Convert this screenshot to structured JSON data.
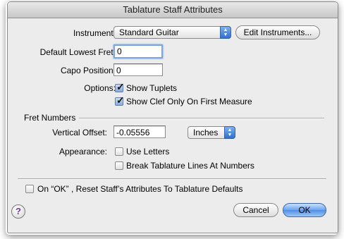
{
  "window": {
    "title": "Tablature Staff Attributes"
  },
  "instrument": {
    "label": "Instrument:",
    "value": "Standard Guitar",
    "edit_button": "Edit Instruments..."
  },
  "lowest_fret": {
    "label": "Default Lowest Fret:",
    "value": "0"
  },
  "capo": {
    "label": "Capo Position:",
    "value": "0"
  },
  "options": {
    "label": "Options:",
    "show_tuplets": {
      "label": "Show Tuplets",
      "checked": true
    },
    "show_clef": {
      "label": "Show Clef Only On First Measure",
      "checked": true
    }
  },
  "fret_numbers": {
    "heading": "Fret Numbers",
    "vertical_offset": {
      "label": "Vertical Offset:",
      "value": "-0.05556",
      "unit": "Inches"
    },
    "appearance": {
      "label": "Appearance:",
      "use_letters": {
        "label": "Use Letters",
        "checked": false
      },
      "break_lines": {
        "label": "Break Tablature Lines At Numbers",
        "checked": false
      }
    }
  },
  "reset": {
    "label": "On “OK” , Reset Staff’s Attributes To Tablature Defaults",
    "checked": false
  },
  "help": {
    "label": "?"
  },
  "buttons": {
    "cancel": "Cancel",
    "ok": "OK"
  }
}
